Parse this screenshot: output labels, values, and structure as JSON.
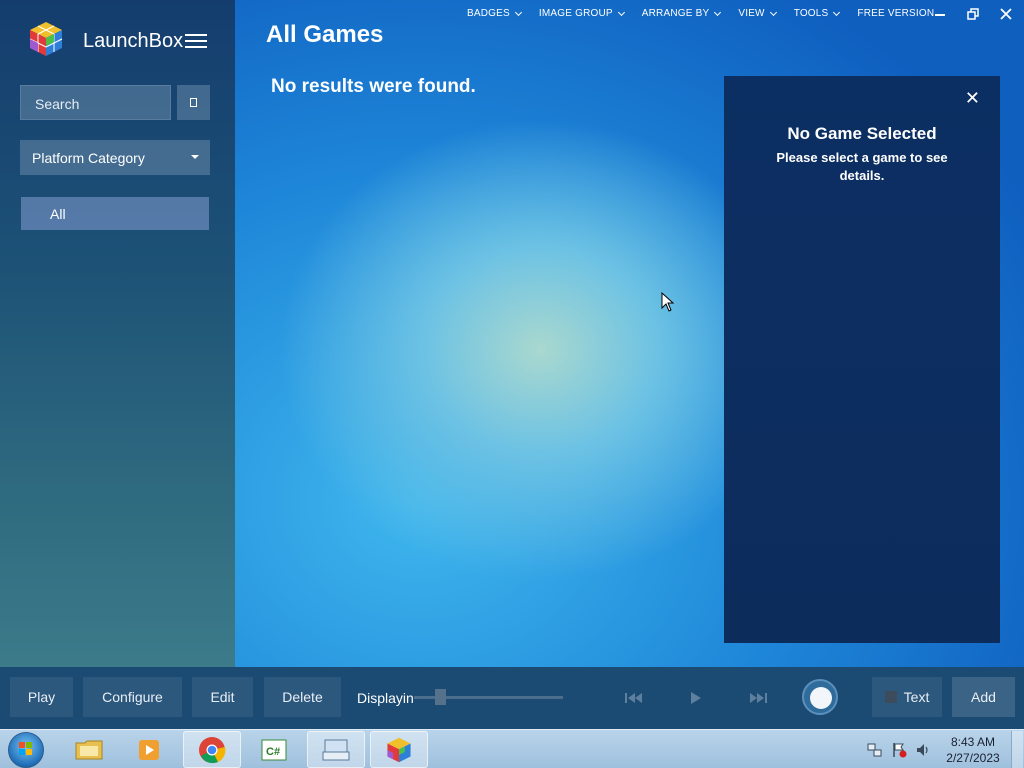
{
  "app": {
    "name": "LaunchBox"
  },
  "sidebar": {
    "search_placeholder": "Search",
    "filter_select": "Platform Category",
    "items": [
      {
        "label": "All"
      }
    ]
  },
  "main": {
    "title": "All Games",
    "empty_message": "No results were found."
  },
  "top_menu": {
    "items": [
      {
        "label": "BADGES"
      },
      {
        "label": "IMAGE GROUP"
      },
      {
        "label": "ARRANGE BY"
      },
      {
        "label": "VIEW"
      },
      {
        "label": "TOOLS"
      },
      {
        "label": "FREE VERSION"
      }
    ]
  },
  "details": {
    "title": "No Game Selected",
    "message": "Please select a game to see details."
  },
  "bottom_bar": {
    "play": "Play",
    "configure": "Configure",
    "edit": "Edit",
    "delete": "Delete",
    "display_label": "Displayin",
    "text_toggle": "Text",
    "add": "Add"
  },
  "taskbar": {
    "time": "8:43 AM",
    "date": "2/27/2023"
  },
  "colors": {
    "sidebar": "#1d5276",
    "bottom_bar": "#1b4a72",
    "details_panel": "#0c2f63",
    "accent": "#2f8fe0"
  }
}
